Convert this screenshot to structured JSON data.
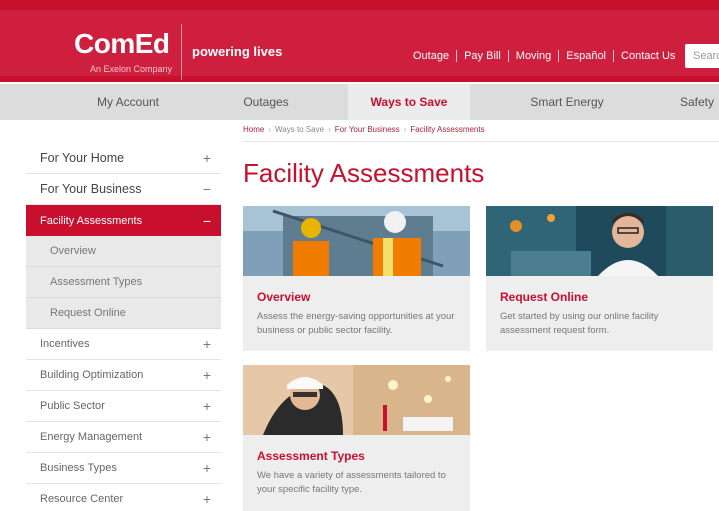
{
  "header": {
    "logo": "ComEd",
    "logo_sub": "An Exelon Company",
    "tagline": "powering lives",
    "utility_links": [
      "Outage",
      "Pay Bill",
      "Moving",
      "Español",
      "Contact Us"
    ],
    "search_placeholder": "Searc"
  },
  "mainnav": {
    "items": [
      "My Account",
      "Outages",
      "Ways to Save",
      "Smart Energy",
      "Safety"
    ],
    "active": "Ways to Save"
  },
  "breadcrumb": [
    "Home",
    "Ways to Save",
    "For Your Business",
    "Facility Assessments"
  ],
  "page_title": "Facility Assessments",
  "sidebar": {
    "items": [
      {
        "label": "For Your Home",
        "sign": "+"
      },
      {
        "label": "For Your Business",
        "sign": "−"
      },
      {
        "label": "Facility Assessments",
        "sign": "−"
      },
      {
        "label": "Overview"
      },
      {
        "label": "Assessment Types"
      },
      {
        "label": "Request Online"
      },
      {
        "label": "Incentives",
        "sign": "+"
      },
      {
        "label": "Building Optimization",
        "sign": "+"
      },
      {
        "label": "Public Sector",
        "sign": "+"
      },
      {
        "label": "Energy Management",
        "sign": "+"
      },
      {
        "label": "Business Types",
        "sign": "+"
      },
      {
        "label": "Resource Center",
        "sign": "+"
      }
    ]
  },
  "cards": [
    {
      "title": "Overview",
      "desc": "Assess the energy-saving opportunities at your business or public sector facility."
    },
    {
      "title": "Request Online",
      "desc": "Get started by using our online facility assessment request form."
    },
    {
      "title": "Assessment Types",
      "desc": "We have a variety of assessments tailored to your specific facility type."
    }
  ],
  "colors": {
    "brand": "#c8102e",
    "nav_bg": "#dcdcdc",
    "card_bg": "#eeeeee"
  }
}
